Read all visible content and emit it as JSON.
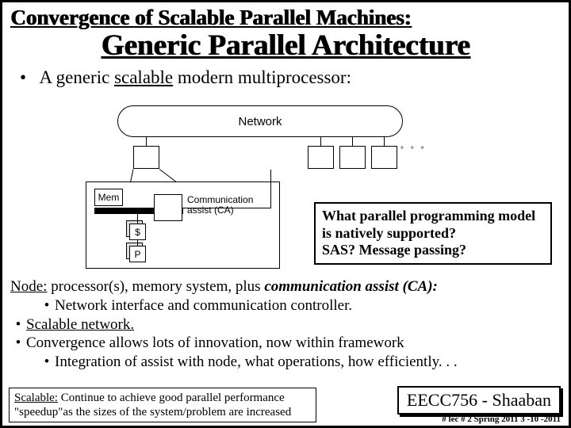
{
  "title1": "Convergence of Scalable Parallel Machines:",
  "title2": "Generic Parallel Architecture",
  "top_bullet_prefix": "A generic ",
  "top_bullet_scalable": "scalable",
  "top_bullet_suffix": " modern multiprocessor:",
  "diagram": {
    "network": "Network",
    "mem": "Mem",
    "ca_line1": "Communication",
    "ca_line2": "assist (CA)",
    "cache": "$",
    "processor": "P",
    "dots": "° ° °"
  },
  "qbox": {
    "l1": "What parallel programming model",
    "l2": "is natively supported?",
    "l3": "SAS?  Message passing?"
  },
  "lower": {
    "node_lead": "Node:",
    "node_rest": " processor(s), memory system, plus ",
    "node_em": "communication assist (CA):",
    "sub1": "Network interface and communication controller.",
    "b2": "Scalable network.",
    "b3": "Convergence allows lots of innovation, now within framework",
    "sub3": "Integration of assist with node, what operations, how efficiently. . ."
  },
  "scalebox": {
    "lead": "Scalable:",
    "rest": "  Continue to achieve good parallel performance \"speedup\"as the sizes of the system/problem are increased"
  },
  "course": "EECC756 - Shaaban",
  "footmeta": "#   lec # 2    Spring 2011  3 -10 -2011"
}
